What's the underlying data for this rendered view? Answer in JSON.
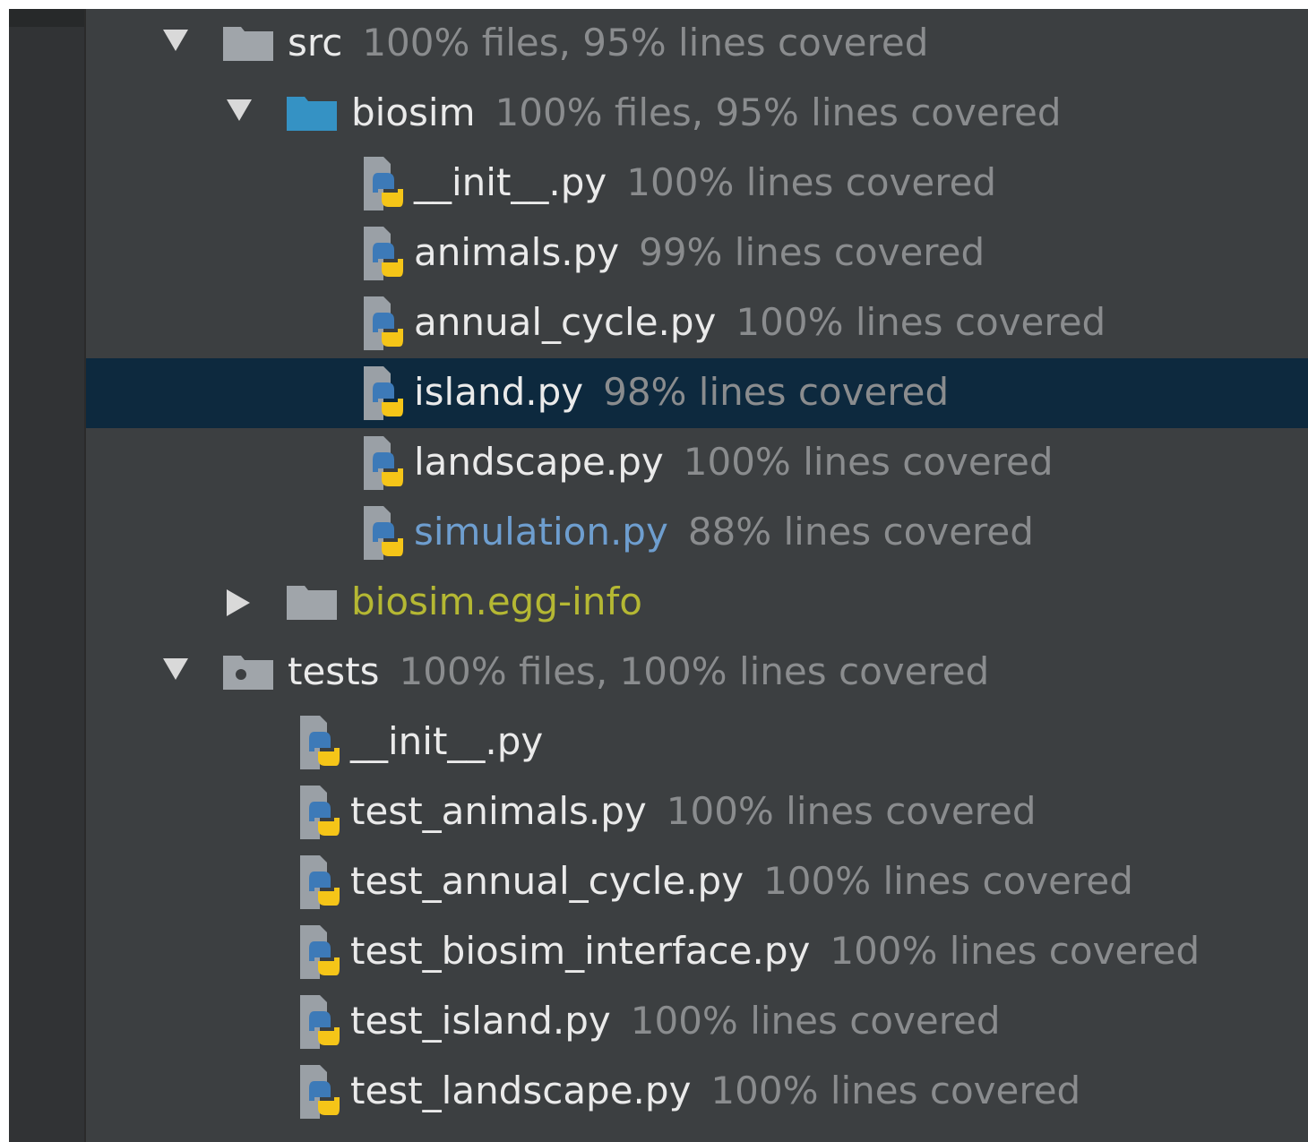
{
  "colors": {
    "panel_bg": "#3c3f41",
    "selected_row": "#0d293e",
    "coverage_text": "#8a8c8e",
    "modified_file": "#6e9ecf",
    "excluded_folder": "#b5b833"
  },
  "tree": [
    {
      "kind": "folder",
      "icon": "folder-icon",
      "expanded": true,
      "name": "src",
      "coverage": "100% files, 95% lines covered"
    },
    {
      "kind": "folder",
      "icon": "package-folder-icon",
      "expanded": true,
      "name": "biosim",
      "coverage": "100% files, 95% lines covered"
    },
    {
      "kind": "file",
      "icon": "python-file-icon",
      "name": "__init__.py",
      "coverage": "100% lines covered"
    },
    {
      "kind": "file",
      "icon": "python-file-icon",
      "name": "animals.py",
      "coverage": "99% lines covered"
    },
    {
      "kind": "file",
      "icon": "python-file-icon",
      "name": "annual_cycle.py",
      "coverage": "100% lines covered"
    },
    {
      "kind": "file",
      "icon": "python-file-icon",
      "name": "island.py",
      "coverage": "98% lines covered",
      "selected": true
    },
    {
      "kind": "file",
      "icon": "python-file-icon",
      "name": "landscape.py",
      "coverage": "100% lines covered"
    },
    {
      "kind": "file",
      "icon": "python-file-icon",
      "name": "simulation.py",
      "coverage": "88% lines covered",
      "modified": true
    },
    {
      "kind": "folder",
      "icon": "folder-icon",
      "expanded": false,
      "name": "biosim.egg-info",
      "coverage": "",
      "excluded": true
    },
    {
      "kind": "folder",
      "icon": "test-folder-icon",
      "expanded": true,
      "name": "tests",
      "coverage": "100% files, 100% lines covered"
    },
    {
      "kind": "file",
      "icon": "python-file-icon",
      "name": "__init__.py",
      "coverage": ""
    },
    {
      "kind": "file",
      "icon": "python-file-icon",
      "name": "test_animals.py",
      "coverage": "100% lines covered"
    },
    {
      "kind": "file",
      "icon": "python-file-icon",
      "name": "test_annual_cycle.py",
      "coverage": "100% lines covered"
    },
    {
      "kind": "file",
      "icon": "python-file-icon",
      "name": "test_biosim_interface.py",
      "coverage": "100% lines covered"
    },
    {
      "kind": "file",
      "icon": "python-file-icon",
      "name": "test_island.py",
      "coverage": "100% lines covered"
    },
    {
      "kind": "file",
      "icon": "python-file-icon",
      "name": "test_landscape.py",
      "coverage": "100% lines covered"
    }
  ]
}
